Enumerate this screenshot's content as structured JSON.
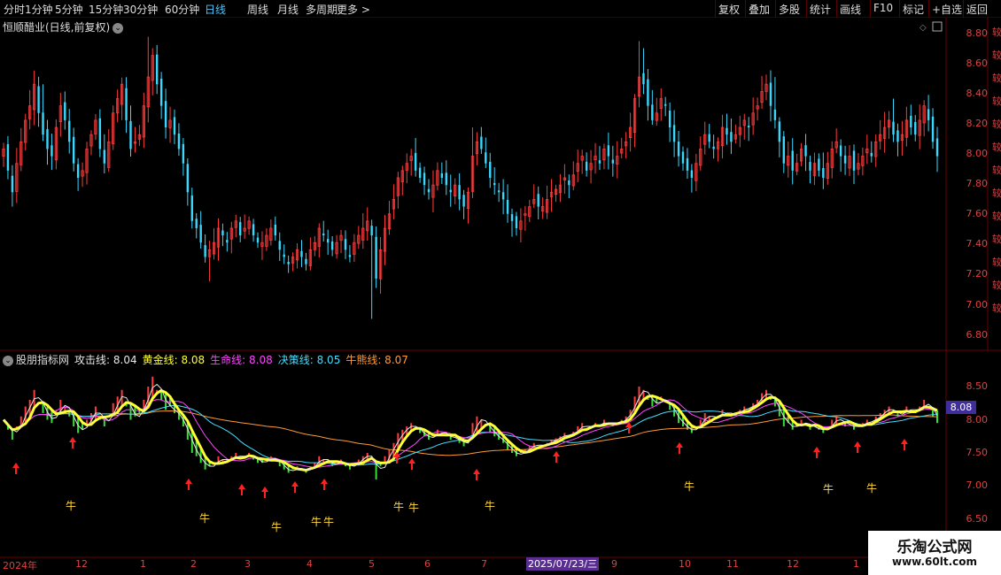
{
  "toolbar": {
    "left": [
      "分时",
      "1分钟",
      "5分钟",
      "15分钟",
      "30分钟",
      "60分钟",
      "日线",
      "周线",
      "月线",
      "多周期",
      "更多 >"
    ],
    "active_index": 6,
    "right": [
      "复权",
      "叠加",
      "多股",
      "统计",
      "画线",
      "F10",
      "标记",
      "+自选",
      "返回"
    ]
  },
  "main_title": "恒顺醋业(日线,前复权)",
  "main_axis": [
    "8.80",
    "8.60",
    "8.40",
    "8.20",
    "8.00",
    "7.80",
    "7.60",
    "7.40",
    "7.20",
    "7.00",
    "6.80"
  ],
  "indicator": {
    "name": "股朋指标网",
    "items": [
      {
        "label": "攻击线:",
        "value": "8.04",
        "color": "#e8e8e8"
      },
      {
        "label": "黄金线:",
        "value": "8.08",
        "color": "#ffff33"
      },
      {
        "label": "生命线:",
        "value": "8.08",
        "color": "#ff44ff"
      },
      {
        "label": "决策线:",
        "value": "8.05",
        "color": "#44ddff"
      },
      {
        "label": "牛熊线:",
        "value": "8.07",
        "color": "#ff9a33"
      }
    ],
    "axis": [
      "8.50",
      "8.00",
      "7.50",
      "7.00",
      "6.50"
    ],
    "current_tag": "8.08",
    "niu_char": "牛"
  },
  "dates": {
    "labels": [
      "2024年",
      "12",
      "1",
      "2",
      "3",
      "4",
      "5",
      "6",
      "7",
      "9",
      "10",
      "11",
      "12",
      "1"
    ],
    "highlight": "2025/07/23/三"
  },
  "watermark": {
    "line1": "乐淘公式网",
    "line2": "www.60lt.com"
  },
  "side_glyphs": [
    "较",
    "较",
    "较",
    "较",
    "较",
    "较",
    "较",
    "较",
    "较",
    "较",
    "较",
    "较",
    "较"
  ],
  "chart_data": {
    "type": "candlestick",
    "title": "恒顺醋业(日线,前复权)",
    "ylim": [
      6.7,
      8.9
    ],
    "closes": [
      8.0,
      7.85,
      7.7,
      7.9,
      8.05,
      8.2,
      8.3,
      8.45,
      8.25,
      8.1,
      8.0,
      7.95,
      8.15,
      8.3,
      8.2,
      8.05,
      7.9,
      7.8,
      7.85,
      8.0,
      8.1,
      8.2,
      8.0,
      7.9,
      8.05,
      8.25,
      8.35,
      8.45,
      8.2,
      8.0,
      8.05,
      8.1,
      8.3,
      8.5,
      8.65,
      8.45,
      8.3,
      8.15,
      8.2,
      8.1,
      8.0,
      7.9,
      7.7,
      7.5,
      7.45,
      7.35,
      7.25,
      7.3,
      7.35,
      7.45,
      7.4,
      7.35,
      7.45,
      7.5,
      7.4,
      7.45,
      7.5,
      7.4,
      7.35,
      7.35,
      7.4,
      7.45,
      7.4,
      7.3,
      7.25,
      7.2,
      7.25,
      7.3,
      7.25,
      7.2,
      7.3,
      7.35,
      7.45,
      7.4,
      7.35,
      7.3,
      7.35,
      7.4,
      7.3,
      7.25,
      7.35,
      7.4,
      7.45,
      7.5,
      7.4,
      7.1,
      7.3,
      7.45,
      7.55,
      7.65,
      7.8,
      7.85,
      7.9,
      7.95,
      7.85,
      7.8,
      7.75,
      7.7,
      7.75,
      7.85,
      7.8,
      7.75,
      7.7,
      7.75,
      7.65,
      7.6,
      7.7,
      7.95,
      8.05,
      8.0,
      7.9,
      7.8,
      7.75,
      7.7,
      7.65,
      7.55,
      7.5,
      7.45,
      7.5,
      7.55,
      7.6,
      7.65,
      7.6,
      7.6,
      7.65,
      7.7,
      7.72,
      7.75,
      7.8,
      7.75,
      7.82,
      7.9,
      7.95,
      7.85,
      7.9,
      7.95,
      7.9,
      8.0,
      7.95,
      7.9,
      7.95,
      8.0,
      8.05,
      8.15,
      8.35,
      8.5,
      8.45,
      8.3,
      8.2,
      8.25,
      8.35,
      8.3,
      8.15,
      8.05,
      7.95,
      7.9,
      7.85,
      7.8,
      7.9,
      8.0,
      8.1,
      8.05,
      8.0,
      8.05,
      8.15,
      8.1,
      8.05,
      8.1,
      8.15,
      8.2,
      8.15,
      8.25,
      8.3,
      8.4,
      8.45,
      8.3,
      8.2,
      8.05,
      7.9,
      7.95,
      7.85,
      7.9,
      8.0,
      7.95,
      7.85,
      7.9,
      7.85,
      7.8,
      7.9,
      8.0,
      8.05,
      7.95,
      7.9,
      7.95,
      7.85,
      7.9,
      7.95,
      8.0,
      7.95,
      8.05,
      8.1,
      8.15,
      8.2,
      8.1,
      8.05,
      8.1,
      8.2,
      8.15,
      8.1,
      8.2,
      8.3,
      8.2,
      8.05,
      7.95
    ]
  }
}
